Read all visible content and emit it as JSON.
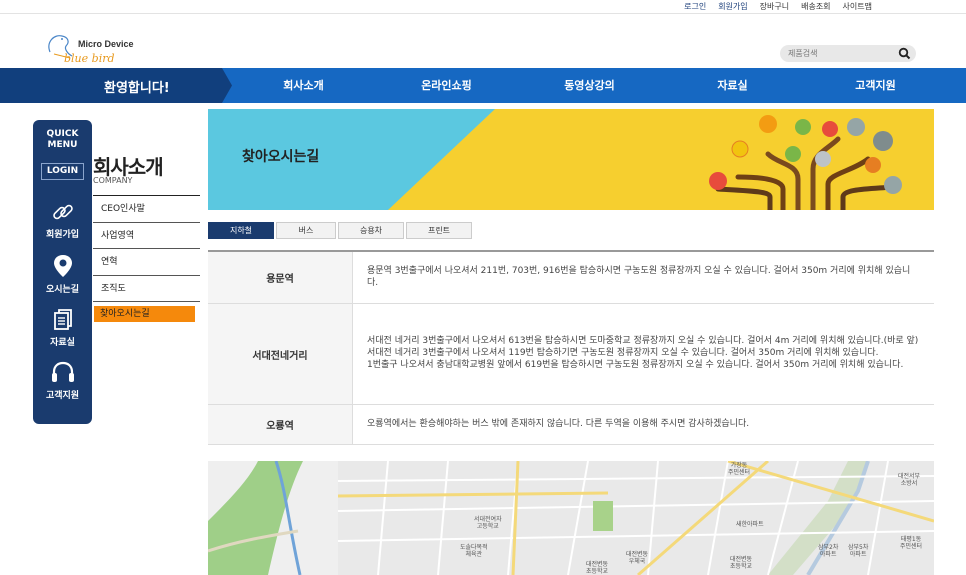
{
  "util_links": [
    "로그인",
    "회원가입",
    "장바구니",
    "배송조회",
    "사이트맵"
  ],
  "logo": {
    "line1": "Micro Device",
    "line2": "blue bird"
  },
  "search": {
    "placeholder": "제품검색"
  },
  "nav": {
    "welcome": "환영합니다!",
    "items": [
      "회사소개",
      "온라인쇼핑",
      "동영상강의",
      "자료실",
      "고객지원"
    ]
  },
  "quick_menu": {
    "title": "QUICK\nMENU",
    "login": "LOGIN",
    "items": [
      {
        "label": "회원가입",
        "icon": "link-icon"
      },
      {
        "label": "오시는길",
        "icon": "location-pin-icon"
      },
      {
        "label": "자료실",
        "icon": "documents-icon"
      },
      {
        "label": "고객지원",
        "icon": "headset-icon"
      }
    ]
  },
  "sub_menu": {
    "title": "회사소개",
    "subtitle": "COMPANY",
    "items": [
      "CEO인사말",
      "사업영역",
      "연혁",
      "조직도",
      "찾아오시는길"
    ],
    "active_index": 4
  },
  "banner": {
    "title": "찾아오시는길"
  },
  "tabs": {
    "items": [
      "지하철",
      "버스",
      "승용차",
      "프린트"
    ],
    "active_index": 0
  },
  "routes": [
    {
      "name": "용문역",
      "lines": [
        "용문역 3번출구에서 나오셔서 211번, 703번, 916번을 탑승하시면 구농도원 정류장까지 오실 수 있습니다. 걸어서 350m 거리에 위치해 있습니다."
      ]
    },
    {
      "name": "서대전네거리",
      "lines": [
        "서대전 네거리 3번출구에서 나오셔서 613번을 탑승하시면 도마중학교 정류장까지 오실 수 있습니다. 걸어서 4m 거리에 위치해 있습니다.(바로 앞)",
        "서대전 네거리 3번출구에서 나오셔서 119번 탑승하기면 구농도원 정류장까지 오실 수 있습니다. 걸어서 350m 거리에 위치해 있습니다.",
        "1번출구 나오셔서 충남대학교병원 앞에서 619번을 탑승하시면 구농도원 정류장까지 오실 수 있습니다. 걸어서 350m 거리에 위치해 있습니다."
      ]
    },
    {
      "name": "오룡역",
      "lines": [
        "오룡역에서는 환승해야하는 버스 밖에 존재하지 않습니다. 다른 두역을 이용해 주시면 감사하겠습니다."
      ]
    }
  ],
  "map": {
    "labels": [
      "가장동\n주민센터",
      "서대전여자\n고등학교",
      "도솔다목적\n체육관",
      "대전변동\n우체국",
      "대전변동\n초등학교",
      "대전변동\n초등학교",
      "새한아파트",
      "삼부2차\n아파트",
      "삼부5차\n아파트",
      "태평1동\n주민센터",
      "대전서부\n소방서"
    ]
  },
  "colors": {
    "nav_blue": "#1668c2",
    "nav_dark": "#113f7d",
    "quick_bg": "#1a3b6e",
    "active_orange": "#f5890c",
    "banner_yellow": "#f6cf2f",
    "banner_cyan": "#5bc8e0"
  }
}
